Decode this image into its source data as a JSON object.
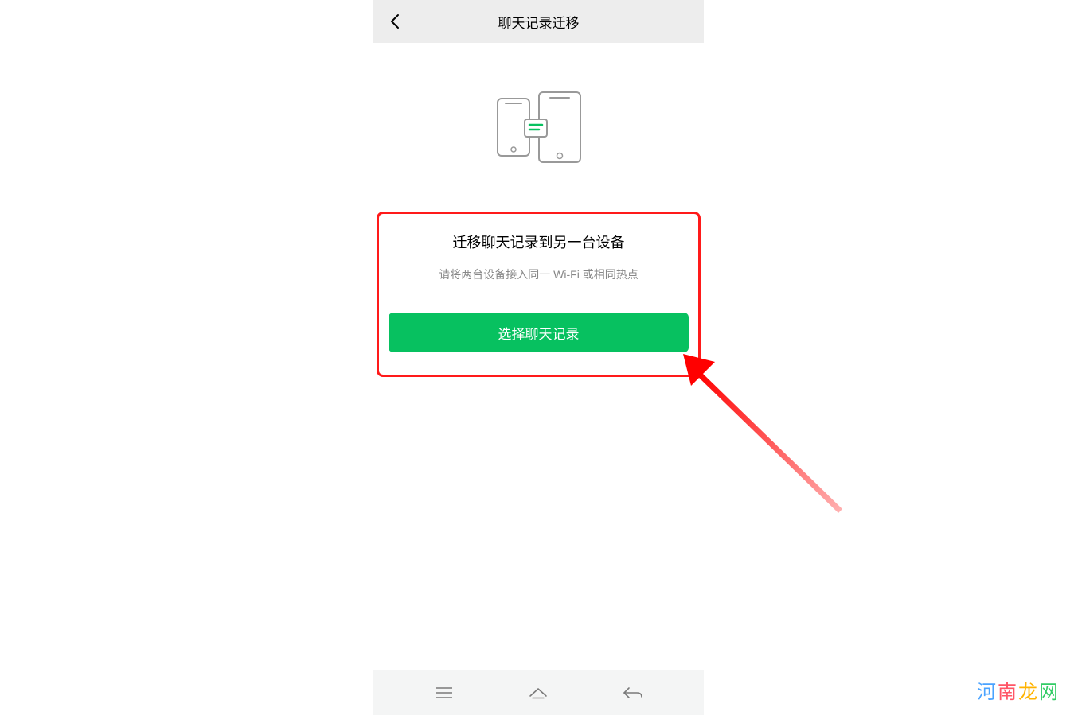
{
  "header": {
    "title": "聊天记录迁移"
  },
  "transfer": {
    "title": "迁移聊天记录到另一台设备",
    "subtitle": "请将两台设备接入同一 Wi-Fi 或相同热点",
    "button_label": "选择聊天记录"
  },
  "icons": {
    "back": "back-chevron-icon",
    "recent": "recent-apps-icon",
    "home": "home-icon",
    "nav_back": "nav-back-icon",
    "phones": "phone-transfer-icon"
  },
  "watermark": {
    "c1": "河",
    "c2": "南",
    "c3": "龙",
    "c4": "网"
  },
  "colors": {
    "accent_green": "#07c160",
    "highlight_red": "#ff1a1a",
    "header_bg": "#ededed",
    "subtitle_gray": "#888888"
  }
}
